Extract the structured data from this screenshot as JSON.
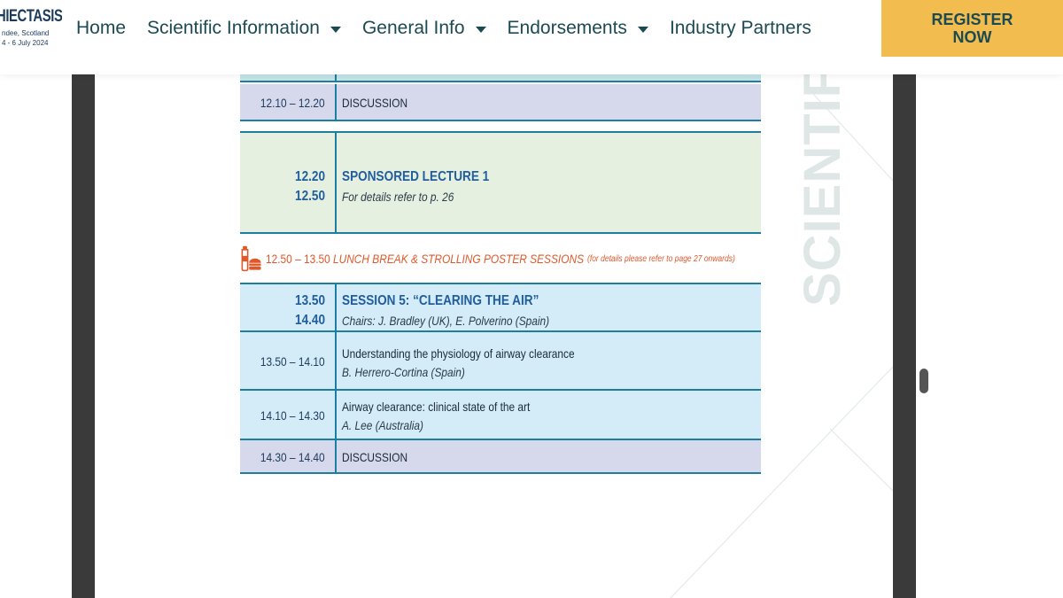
{
  "logo": {
    "main": "HIECTASIS",
    "sub1": "ndee, Scotland",
    "sub2": "4 - 6 July 2024"
  },
  "nav": {
    "items": [
      {
        "label": "Home",
        "dropdown": false
      },
      {
        "label": "Scientific Information",
        "dropdown": true
      },
      {
        "label": "General Info",
        "dropdown": true
      },
      {
        "label": "Endorsements",
        "dropdown": true
      },
      {
        "label": "Industry Partners",
        "dropdown": false
      }
    ],
    "register_line1": "REGISTER",
    "register_line2": "NOW"
  },
  "watermark": "SCIENTIFIC P",
  "programme": {
    "discussion1": {
      "time": "12.10 – 12.20",
      "title": "DISCUSSION"
    },
    "sponsored": {
      "start": "12.20",
      "end": "12.50",
      "title": "SPONSORED LECTURE 1",
      "note": "For details refer to p. 26"
    },
    "lunch": {
      "time": "12.50 – 13.50",
      "title": "LUNCH BREAK & STROLLING POSTER SESSIONS",
      "note": "(for details please refer to page 27 onwards)"
    },
    "session5": {
      "start": "13.50",
      "end": "14.40",
      "title": "SESSION 5: “CLEARING THE AIR”",
      "chairs": "Chairs: J. Bradley (UK), E. Polverino (Spain)"
    },
    "talk1": {
      "time": "13.50 – 14.10",
      "title": "Understanding the physiology of airway clearance",
      "speaker": "B. Herrero-Cortina (Spain)"
    },
    "talk2": {
      "time": "14.10 – 14.30",
      "title": "Airway clearance: clinical state of the art",
      "speaker": "A. Lee (Australia)"
    },
    "discussion2": {
      "time": "14.30 – 14.40",
      "title": "DISCUSSION"
    }
  },
  "colors": {
    "header_text": "#1b4a52",
    "register_bg": "#f2bd4e",
    "discussion_bg": "#d6d9ec",
    "sponsored_bg": "#e6f0e0",
    "session_bg": "#d4ebf8",
    "lunch_text": "#e0582a",
    "rule": "#1e7ea0"
  }
}
